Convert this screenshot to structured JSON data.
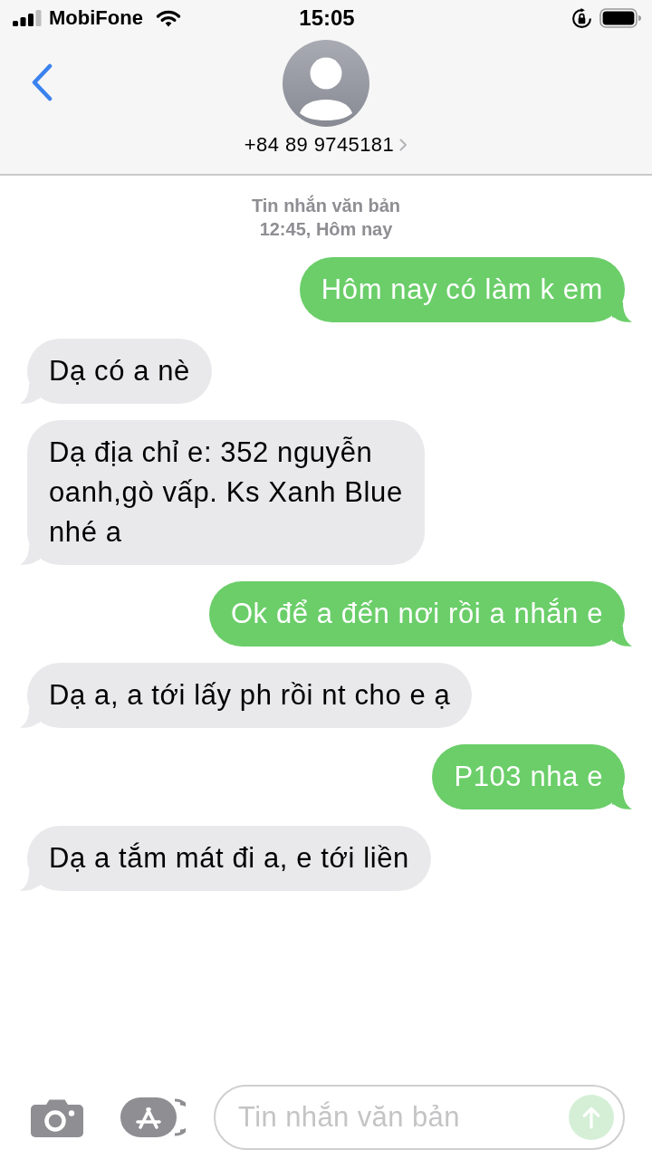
{
  "status_bar": {
    "carrier": "MobiFone",
    "time": "15:05"
  },
  "header": {
    "contact": "+84 89 9745181"
  },
  "conversation": {
    "service": "Tin nhắn văn bản",
    "timestamp": "12:45, Hôm nay",
    "messages": [
      {
        "kind": "sent",
        "text": "Hôm nay có làm k em"
      },
      {
        "kind": "received",
        "text": "Dạ có a nè"
      },
      {
        "kind": "received",
        "text": "Dạ địa chỉ e: 352 nguyễn\noanh,gò vấp. Ks Xanh Blue\nnhé a"
      },
      {
        "kind": "sent",
        "text": "Ok để a đến nơi rồi a nhắn e"
      },
      {
        "kind": "received",
        "text": "Dạ a, a tới lấy ph rồi nt cho e ạ"
      },
      {
        "kind": "sent",
        "text": "P103 nha e"
      },
      {
        "kind": "received",
        "text": "Dạ a tắm mát đi a, e tới liền"
      }
    ]
  },
  "composer": {
    "placeholder": "Tin nhắn văn bản",
    "send_button": {
      "disabled": true
    }
  }
}
